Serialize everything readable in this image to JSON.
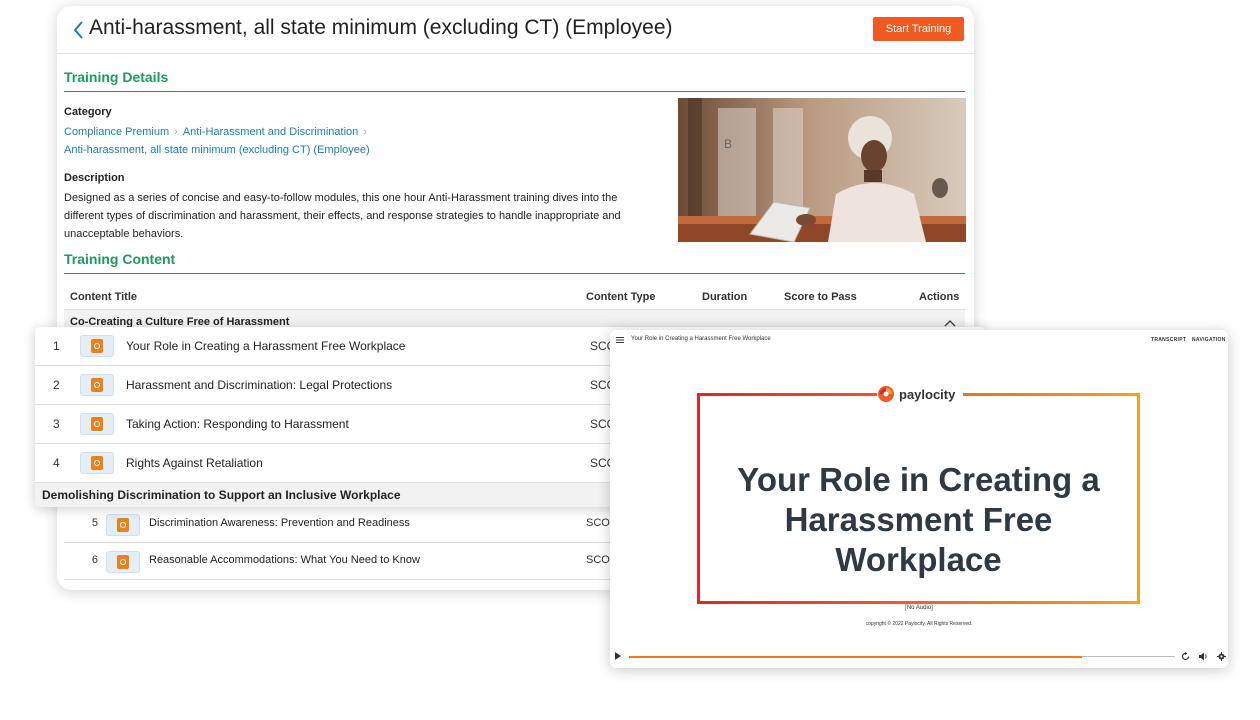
{
  "header": {
    "title": "Anti-harassment, all state minimum (excluding CT) (Employee)",
    "start_button": "Start Training"
  },
  "details": {
    "section_title": "Training Details",
    "category_label": "Category",
    "breadcrumbs": [
      "Compliance Premium",
      "Anti-Harassment and Discrimination",
      "Anti-harassment, all state minimum (excluding CT) (Employee)"
    ],
    "description_label": "Description",
    "description": "Designed as a series of concise and easy-to-follow modules, this one hour Anti-Harassment training dives into the different types of discrimination and harassment, their effects, and response strategies to handle inappropriate and unacceptable behaviors."
  },
  "content": {
    "section_title": "Training Content",
    "columns": [
      "Content Title",
      "Content Type",
      "Duration",
      "Score to Pass",
      "Actions"
    ],
    "groups": [
      {
        "name": "Co-Creating a Culture Free of Harassment",
        "items": [
          {
            "num": "1",
            "title": "Your Role in Creating a Harassment Free Workplace",
            "type": "SCO"
          },
          {
            "num": "2",
            "title": "Harassment and Discrimination: Legal Protections",
            "type": "SCO"
          },
          {
            "num": "3",
            "title": "Taking Action: Responding to Harassment",
            "type": "SCO"
          },
          {
            "num": "4",
            "title": "Rights Against Retaliation",
            "type": "SCO"
          }
        ]
      },
      {
        "name": "Demolishing Discrimination to Support an Inclusive Workplace",
        "items": [
          {
            "num": "5",
            "title": "Discrimination Awareness: Prevention and Readiness",
            "type": "SCOF"
          },
          {
            "num": "6",
            "title": "Reasonable Accommodations: What You Need to Know",
            "type": "SCOF"
          }
        ]
      }
    ]
  },
  "player": {
    "title": "Your Role in Creating a Harassment Free Workplace",
    "links": [
      "TRANSCRIPT",
      "NAVIGATION"
    ],
    "brand": "paylocity",
    "slide_heading": "Your Role in Creating a Harassment Free Workplace",
    "no_audio": "[No Audio]",
    "copyright": "copyright © 2022 Paylocity. All Rights Reserved.",
    "progress": 0.83,
    "colors": {
      "accent": "#ef5a22",
      "frame_left": "#e0262c",
      "frame_right": "#f0a02c"
    }
  },
  "icons": {
    "back": "chevron-left-icon",
    "collapse": "chevron-up-icon",
    "content": "scorm-package-icon",
    "menu": "hamburger-menu-icon",
    "play": "play-icon",
    "replay": "replay-icon",
    "volume": "volume-icon",
    "settings": "gear-icon"
  }
}
